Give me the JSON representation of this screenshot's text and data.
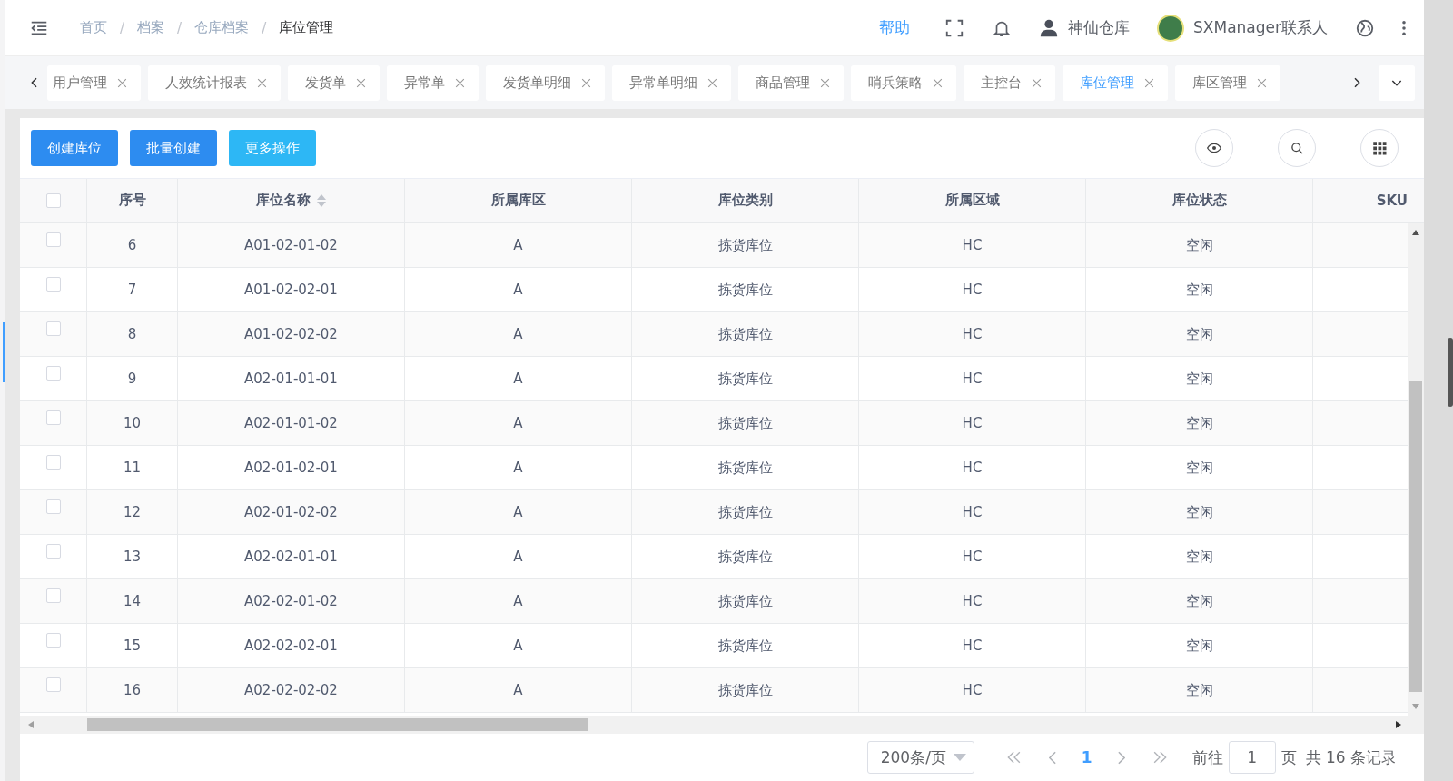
{
  "breadcrumb": [
    {
      "label": "首页",
      "current": false
    },
    {
      "separator": "/",
      "label": "档案",
      "current": false
    },
    {
      "separator": "/",
      "label": "仓库档案",
      "current": false
    },
    {
      "separator": "/",
      "label": "库位管理",
      "current": true
    }
  ],
  "header": {
    "help": "帮助",
    "warehouse": "神仙仓库",
    "account": "SXManager联系人"
  },
  "tabs": [
    {
      "label": "用户管理",
      "selected": false
    },
    {
      "label": "人效统计报表",
      "selected": false
    },
    {
      "label": "发货单",
      "selected": false
    },
    {
      "label": "异常单",
      "selected": false
    },
    {
      "label": "发货单明细",
      "selected": false
    },
    {
      "label": "异常单明细",
      "selected": false
    },
    {
      "label": "商品管理",
      "selected": false
    },
    {
      "label": "哨兵策略",
      "selected": false
    },
    {
      "label": "主控台",
      "selected": false
    },
    {
      "label": "库位管理",
      "selected": true
    },
    {
      "label": "库区管理",
      "selected": false
    }
  ],
  "toolbar": {
    "buttons": [
      {
        "label": "创建库位",
        "kind": "primary"
      },
      {
        "label": "批量创建",
        "kind": "primary"
      },
      {
        "label": "更多操作",
        "kind": "info"
      }
    ]
  },
  "table": {
    "select_all_checked": false,
    "columns": [
      {
        "label": "序号",
        "sortable": false
      },
      {
        "label": "库位名称",
        "sortable": true
      },
      {
        "label": "所属库区",
        "sortable": false
      },
      {
        "label": "库位类别",
        "sortable": false
      },
      {
        "label": "所属区域",
        "sortable": false
      },
      {
        "label": "库位状态",
        "sortable": false
      },
      {
        "label": "SKU",
        "sortable": false
      }
    ],
    "rows": [
      {
        "checked": false,
        "cells": [
          "6",
          "A01-02-01-02",
          "A",
          "拣货库位",
          "HC",
          "空闲"
        ]
      },
      {
        "checked": false,
        "cells": [
          "7",
          "A01-02-02-01",
          "A",
          "拣货库位",
          "HC",
          "空闲"
        ]
      },
      {
        "checked": false,
        "cells": [
          "8",
          "A01-02-02-02",
          "A",
          "拣货库位",
          "HC",
          "空闲"
        ]
      },
      {
        "checked": false,
        "cells": [
          "9",
          "A02-01-01-01",
          "A",
          "拣货库位",
          "HC",
          "空闲"
        ]
      },
      {
        "checked": false,
        "cells": [
          "10",
          "A02-01-01-02",
          "A",
          "拣货库位",
          "HC",
          "空闲"
        ]
      },
      {
        "checked": false,
        "cells": [
          "11",
          "A02-01-02-01",
          "A",
          "拣货库位",
          "HC",
          "空闲"
        ]
      },
      {
        "checked": false,
        "cells": [
          "12",
          "A02-01-02-02",
          "A",
          "拣货库位",
          "HC",
          "空闲"
        ]
      },
      {
        "checked": false,
        "cells": [
          "13",
          "A02-02-01-01",
          "A",
          "拣货库位",
          "HC",
          "空闲"
        ]
      },
      {
        "checked": false,
        "cells": [
          "14",
          "A02-02-01-02",
          "A",
          "拣货库位",
          "HC",
          "空闲"
        ]
      },
      {
        "checked": false,
        "cells": [
          "15",
          "A02-02-02-01",
          "A",
          "拣货库位",
          "HC",
          "空闲"
        ]
      },
      {
        "checked": false,
        "cells": [
          "16",
          "A02-02-02-02",
          "A",
          "拣货库位",
          "HC",
          "空闲"
        ]
      }
    ]
  },
  "pagination": {
    "page_size": "200条/页",
    "pages": [
      {
        "label": "1",
        "selected": true
      }
    ],
    "goto_label": "前往",
    "goto_value": "1",
    "goto_suffix": "页",
    "total": "共 16 条记录"
  }
}
